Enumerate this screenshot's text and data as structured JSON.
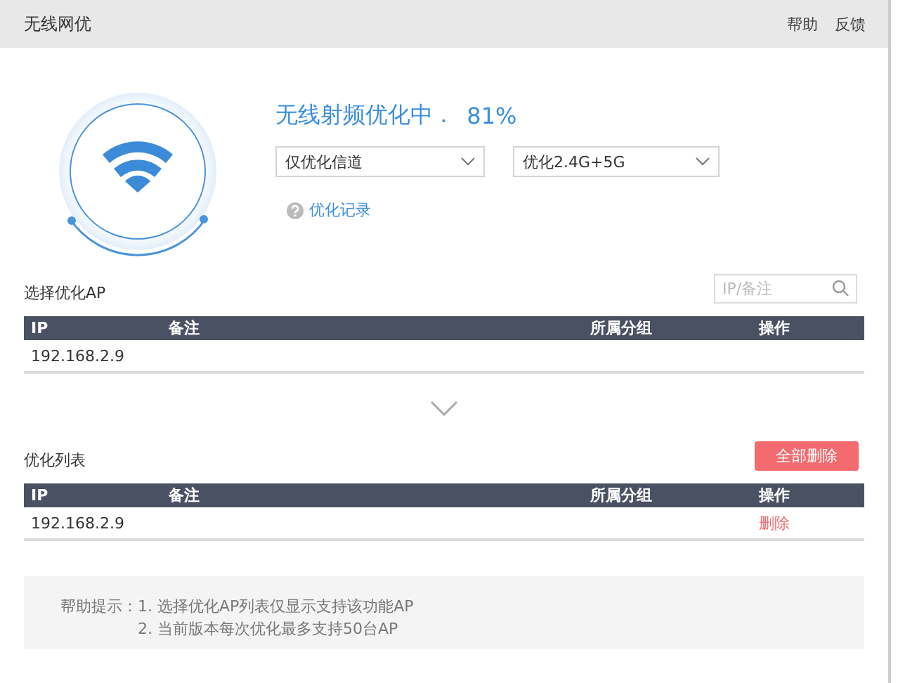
{
  "window": {
    "title": "无线网优",
    "actions": [
      "帮助",
      "反馈"
    ]
  },
  "status": {
    "text": "无线射频优化中 .",
    "percent": "81%"
  },
  "selects": [
    {
      "value": "仅优化信道"
    },
    {
      "value": "优化2.4G+5G"
    }
  ],
  "history_link": "优化记录",
  "select_ap": {
    "title": "选择优化AP",
    "search": {
      "placeholder": "IP/备注"
    },
    "columns": [
      "IP",
      "备注",
      "所属分组",
      "操作"
    ],
    "rows": [
      {
        "ip": "192.168.2.9"
      }
    ]
  },
  "optimize_list": {
    "title": "优化列表",
    "button": "全部删除",
    "columns": [
      "IP",
      "备注",
      "所属分组",
      "操作"
    ],
    "rows": [
      {
        "ip": "192.168.2.9",
        "action": "删除"
      }
    ]
  },
  "help": {
    "label": "帮助提示：",
    "items": [
      "1. 选择优化AP列表仅显示支持该功能AP",
      "2. 当前版本每次优化最多支持50台AP"
    ]
  }
}
